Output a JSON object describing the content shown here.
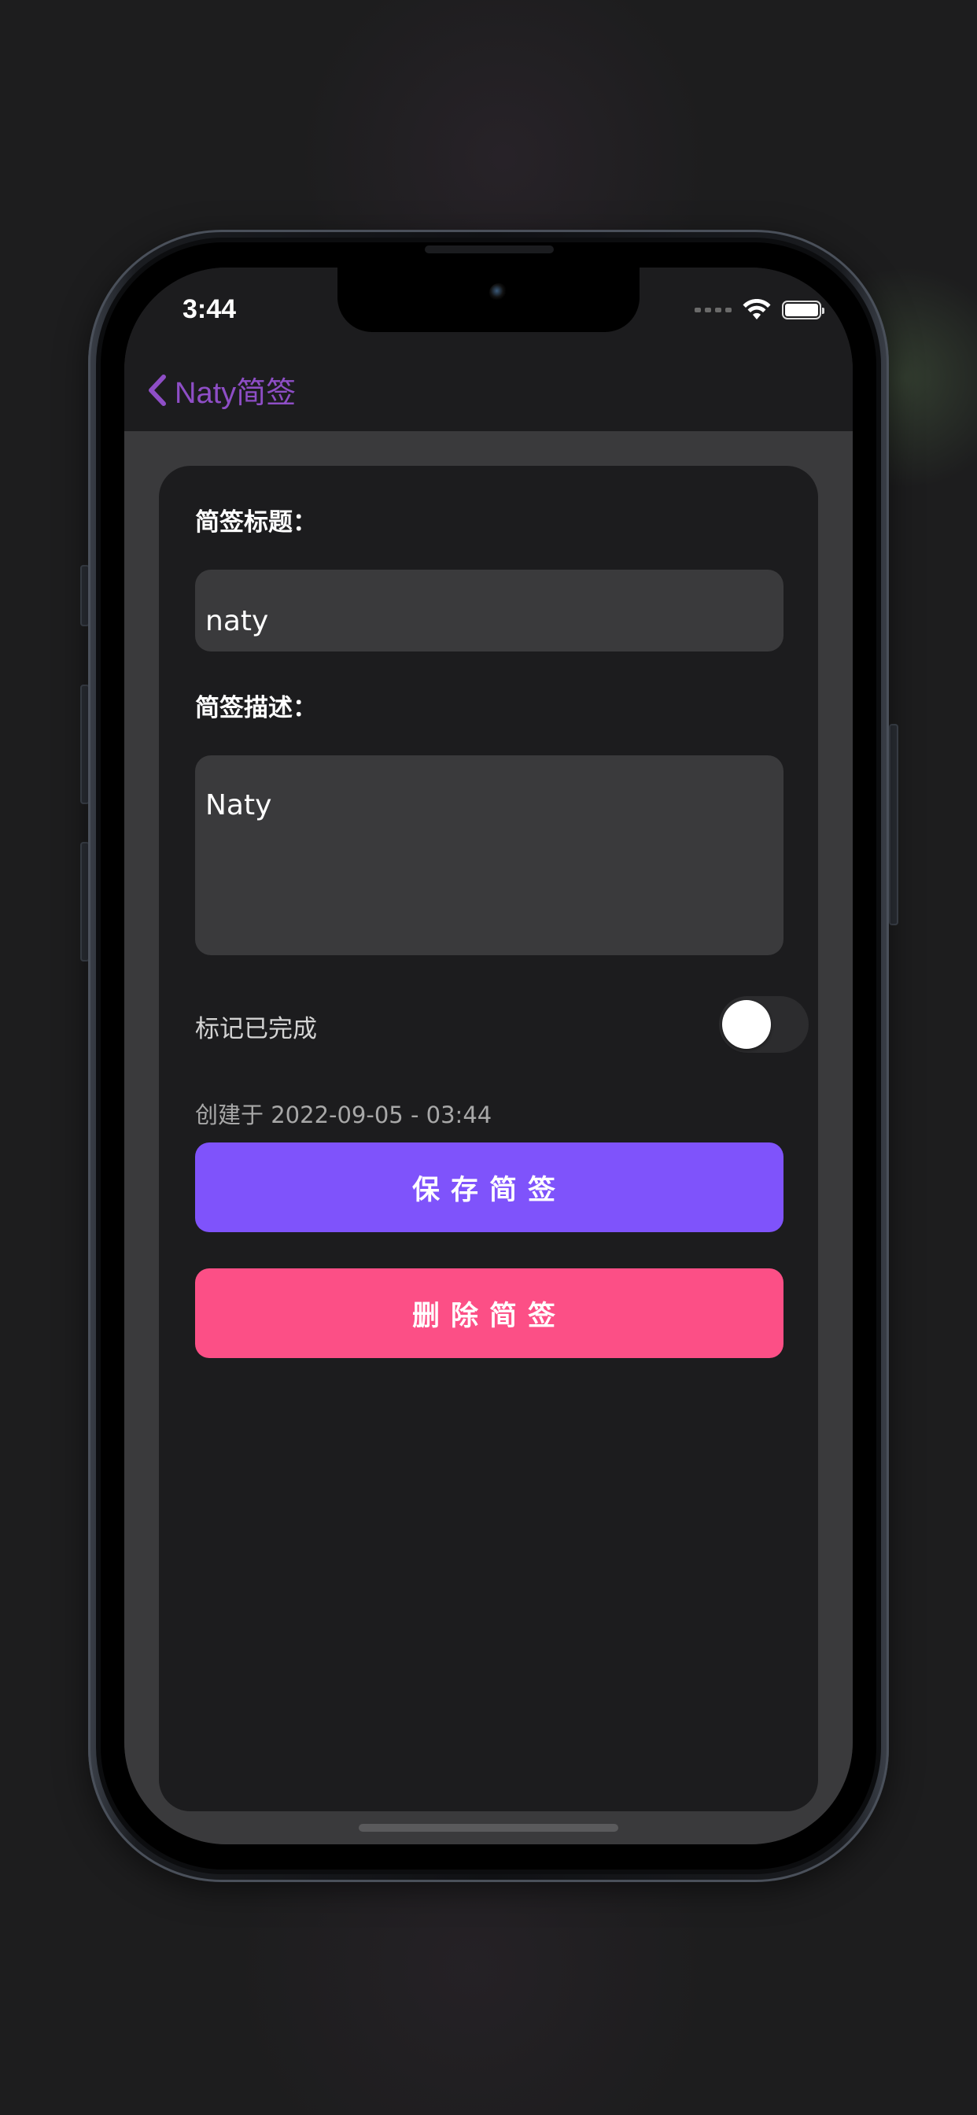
{
  "status_bar": {
    "time": "3:44",
    "icons": [
      "signal-icon",
      "wifi-icon",
      "battery-icon"
    ]
  },
  "nav": {
    "back_label": "Naty简签",
    "accent_color": "#8e4ec6"
  },
  "form": {
    "title_label": "简签标题：",
    "title_value": "naty",
    "description_label": "简签描述：",
    "description_value": "Naty",
    "completed_label": "标记已完成",
    "completed": false,
    "created_text": "创建于 2022-09-05 - 03:44"
  },
  "actions": {
    "save_label": "保存简签",
    "save_color": "#7f53fb",
    "delete_label": "删除简签",
    "delete_color": "#fc4f86"
  }
}
